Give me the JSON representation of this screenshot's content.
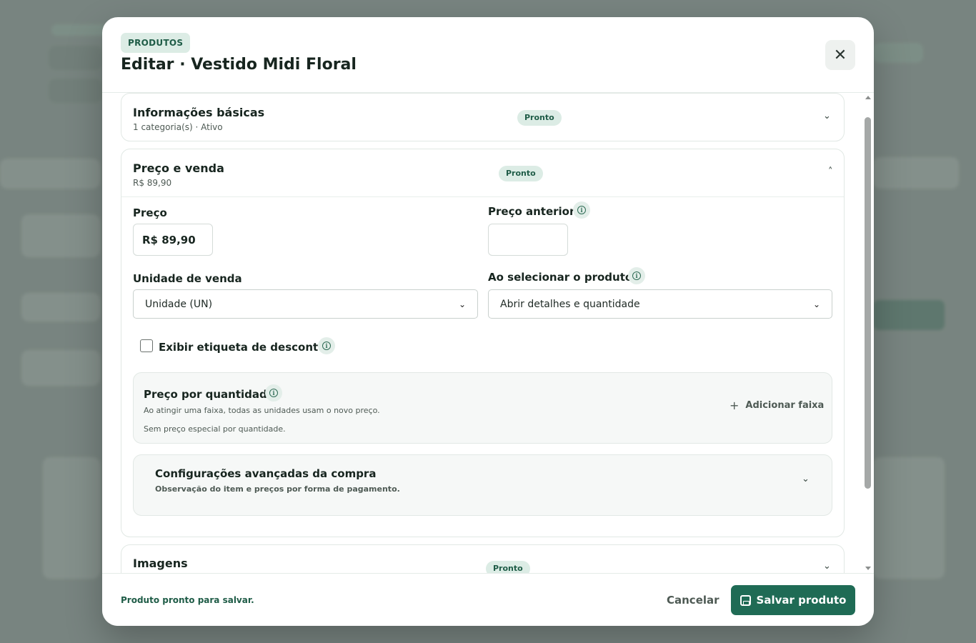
{
  "modal": {
    "section_badge": "PRODUTOS",
    "title": "Editar · Vestido Midi Floral",
    "close_icon": "close-icon"
  },
  "sections": {
    "basic": {
      "title": "Informações básicas",
      "subtitle": "1 categoria(s) · Ativo",
      "status": "Pronto",
      "state": "collapsed"
    },
    "price": {
      "title": "Preço e venda",
      "subtitle": "R$ 89,90",
      "status": "Pronto",
      "state": "expanded",
      "fields": {
        "price_label": "Preço",
        "price_value": "R$ 89,90",
        "previous_price_label": "Preço anterior",
        "previous_price_value": "",
        "unit_label": "Unidade de venda",
        "unit_value": "Unidade (UN)",
        "on_select_label": "Ao selecionar o produto",
        "on_select_value": "Abrir detalhes e quantidade",
        "discount_label": "Exibir etiqueta de desconto",
        "discount_checked": false
      },
      "quantity_pricing": {
        "title": "Preço por quantidade",
        "description": "Ao atingir uma faixa, todas as unidades usam o novo preço.",
        "empty_text": "Sem preço especial por quantidade.",
        "add_button": "Adicionar faixa"
      },
      "advanced": {
        "title": "Configurações avançadas da compra",
        "subtitle": "Observação do item e preços por forma de pagamento."
      }
    },
    "images": {
      "title": "Imagens",
      "status": "Pronto",
      "state": "collapsed"
    }
  },
  "footer": {
    "status": "Produto pronto para salvar.",
    "cancel": "Cancelar",
    "save": "Salvar produto"
  },
  "colors": {
    "primary": "#1f6b55",
    "badge_bg": "#dcece5",
    "badge_text": "#1f5c47"
  }
}
